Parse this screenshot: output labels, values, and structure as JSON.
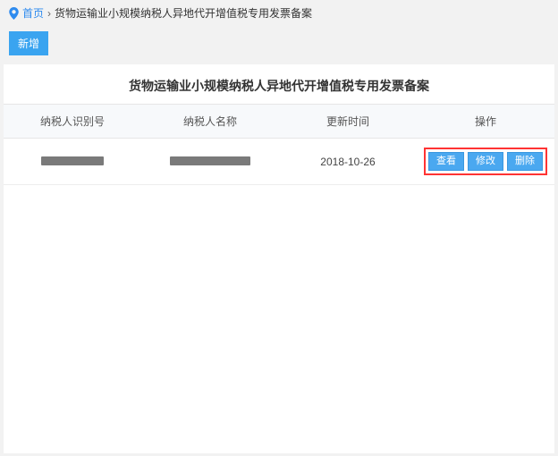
{
  "breadcrumb": {
    "home": "首页",
    "current": "货物运输业小规模纳税人异地代开增值税专用发票备案"
  },
  "buttons": {
    "new": "新增"
  },
  "panel": {
    "title": "货物运输业小规模纳税人异地代开增值税专用发票备案"
  },
  "table": {
    "headers": {
      "taxpayer_id": "纳税人识别号",
      "taxpayer_name": "纳税人名称",
      "update_time": "更新时间",
      "actions": "操作"
    },
    "rows": [
      {
        "taxpayer_id": "",
        "taxpayer_name": "",
        "update_time": "2018-10-26",
        "actions": {
          "view": "查看",
          "edit": "修改",
          "delete": "删除"
        }
      }
    ]
  }
}
